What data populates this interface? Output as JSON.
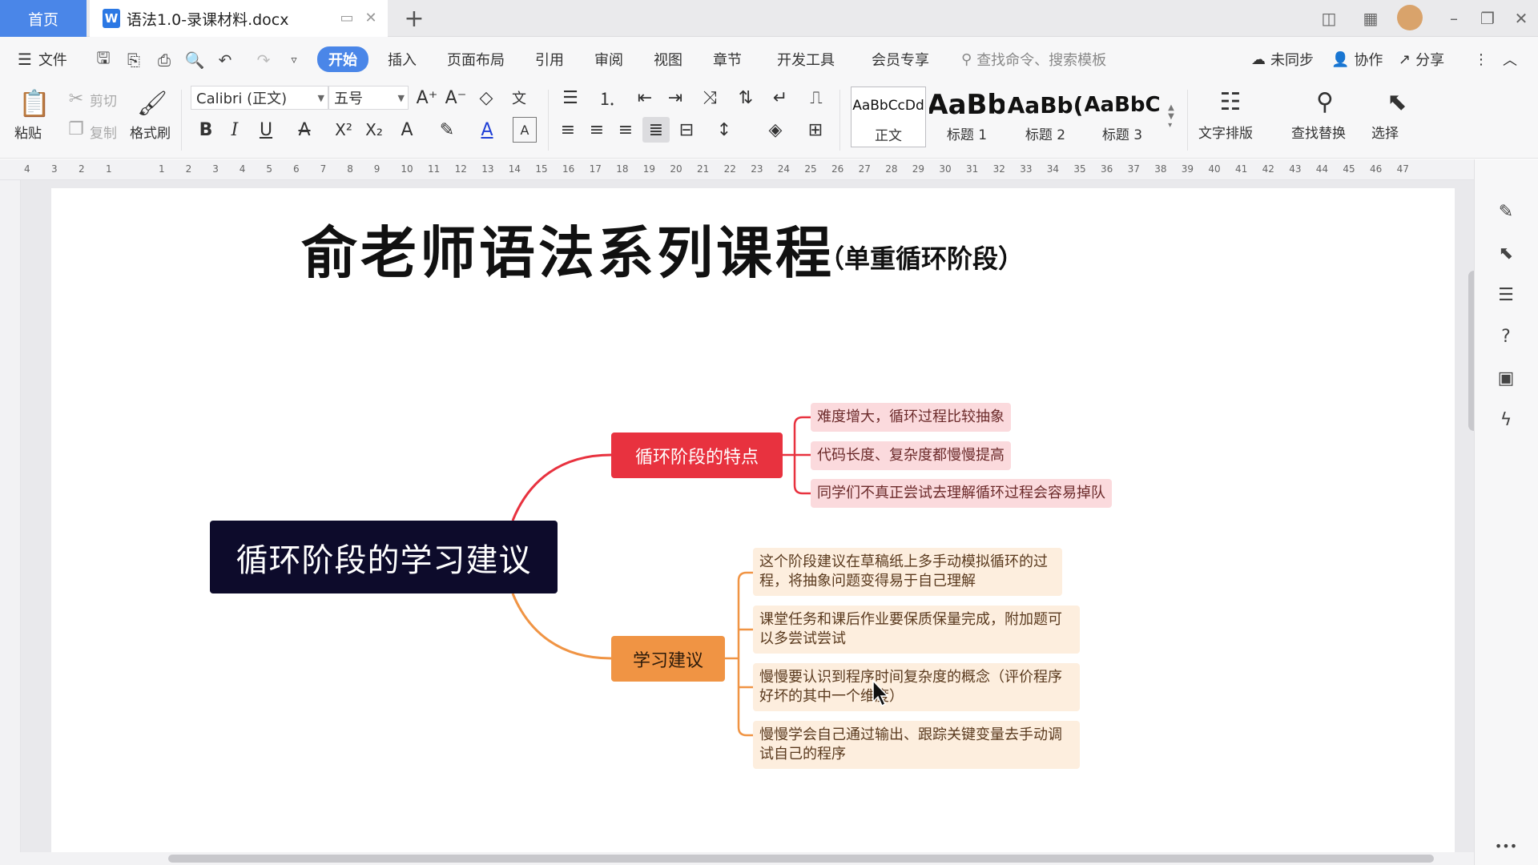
{
  "tabbar": {
    "home_label": "首页",
    "doc_title": "语法1.0-录课材料.docx",
    "doc_icon": "W",
    "new_tab": "+",
    "close": "✕"
  },
  "menubar": {
    "file_label": "文件",
    "tabs": [
      "开始",
      "插入",
      "页面布局",
      "引用",
      "审阅",
      "视图",
      "章节",
      "开发工具",
      "会员专享"
    ],
    "active_tab": "开始",
    "search_placeholder": "查找命令、搜索模板",
    "unsync_label": "未同步",
    "collab_label": "协作",
    "share_label": "分享"
  },
  "ribbon": {
    "paste_label": "粘贴",
    "cut_label": "剪切",
    "copy_label": "复制",
    "format_painter_label": "格式刷",
    "font_name": "Calibri (正文)",
    "font_size": "五号",
    "styles": [
      {
        "preview": "AaBbCcDd",
        "name": "正文"
      },
      {
        "preview": "AaBb",
        "name": "标题 1"
      },
      {
        "preview": "AaBb(",
        "name": "标题 2"
      },
      {
        "preview": "AaBbC",
        "name": "标题 3"
      }
    ],
    "text_layout_label": "文字排版",
    "find_replace_label": "查找替换",
    "select_label": "选择"
  },
  "ruler": {
    "left_ticks": [
      "4",
      "3",
      "2",
      "1"
    ],
    "right_ticks": [
      "1",
      "2",
      "3",
      "4",
      "5",
      "6",
      "7",
      "8",
      "9",
      "10",
      "11",
      "12",
      "13",
      "14",
      "15",
      "16",
      "17",
      "18",
      "19",
      "20",
      "21",
      "22",
      "23",
      "24",
      "25",
      "26",
      "27",
      "28",
      "29",
      "30",
      "31",
      "32",
      "33",
      "34",
      "35",
      "36",
      "37",
      "38",
      "39",
      "40",
      "41",
      "42",
      "43",
      "44",
      "45",
      "46",
      "47"
    ]
  },
  "document": {
    "title": "俞老师语法系列课程",
    "subtitle": "（单重循环阶段）"
  },
  "mindmap": {
    "root": "循环阶段的学习建议",
    "branches": [
      {
        "label": "循环阶段的特点",
        "color": "#e8323f",
        "leaves": [
          "难度增大，循环过程比较抽象",
          "代码长度、复杂度都慢慢提高",
          "同学们不真正尝试去理解循环过程会容易掉队"
        ]
      },
      {
        "label": "学习建议",
        "color": "#f09444",
        "leaves": [
          "这个阶段建议在草稿纸上多手动模拟循环的过程，将抽象问题变得易于自己理解",
          "课堂任务和课后作业要保质保量完成，附加题可以多尝试尝试",
          "慢慢要认识到程序时间复杂度的概念（评价程序好坏的其中一个维度）",
          "慢慢学会自己通过输出、跟踪关键变量去手动调试自己的程序"
        ]
      }
    ]
  },
  "colors": {
    "accent": "#4a86e8",
    "root_bg": "#0d0b2b",
    "branch1": "#e8323f",
    "branch2": "#f09444",
    "leaf1_bg": "#fbdadd",
    "leaf2_bg": "#fdeede"
  }
}
